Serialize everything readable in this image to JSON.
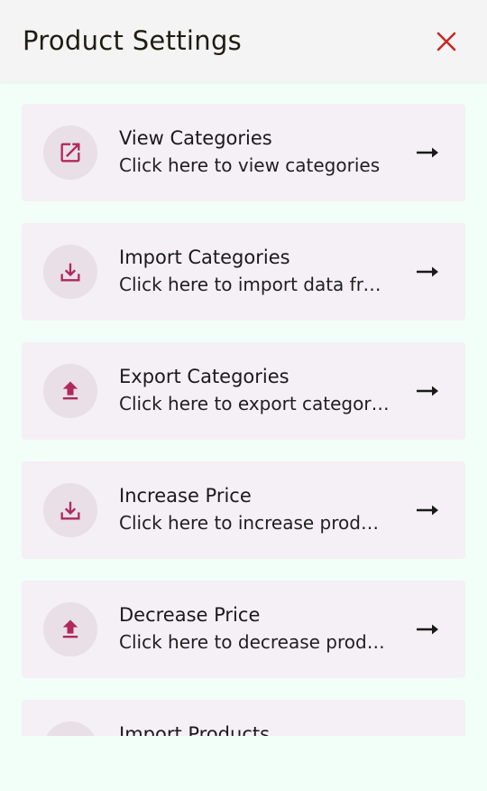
{
  "header": {
    "title": "Product Settings",
    "close_icon": "close-icon",
    "close_color": "#c62828"
  },
  "accent_color": "#b0285e",
  "items": [
    {
      "title": "View Categories",
      "subtitle": "Click here to view categories",
      "icon": "open-in-new-icon"
    },
    {
      "title": "Import Categories",
      "subtitle": "Click here to import data from file",
      "icon": "download-icon"
    },
    {
      "title": "Export Categories",
      "subtitle": "Click here to export categories",
      "icon": "upload-icon"
    },
    {
      "title": "Increase Price",
      "subtitle": "Click here to increase product price",
      "icon": "download-icon"
    },
    {
      "title": "Decrease Price",
      "subtitle": "Click here to decrease product price",
      "icon": "upload-icon"
    },
    {
      "title": "Import Products",
      "subtitle": "",
      "icon": "download-icon"
    }
  ]
}
